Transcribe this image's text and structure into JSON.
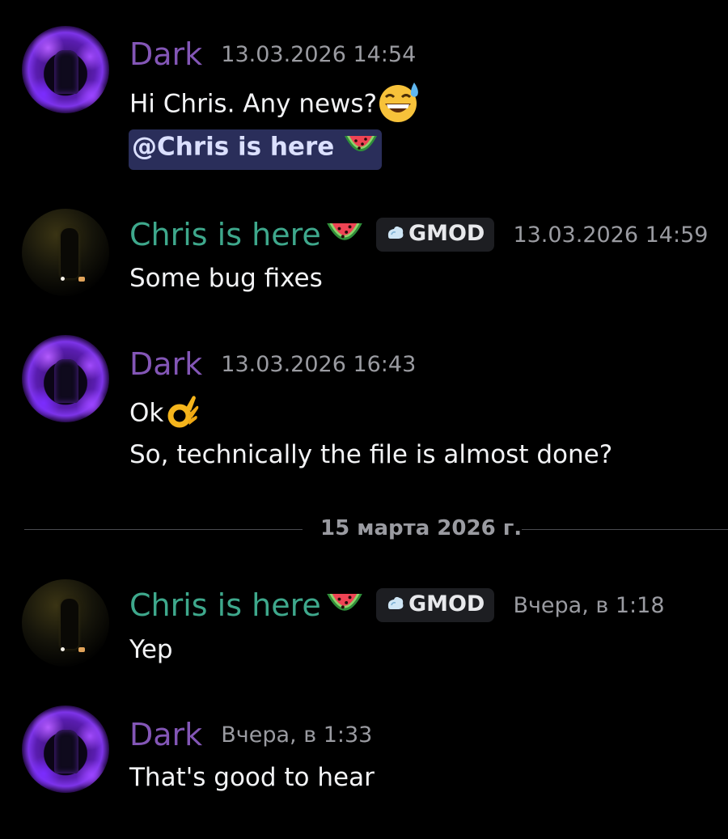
{
  "colors": {
    "background": "#000000",
    "dark_name": "#8356b6",
    "chris_name": "#3ea88c",
    "timestamp": "#9a9ba1",
    "mention_bg": "#2a2e5a",
    "tag_bg": "#1d1e22"
  },
  "messages": [
    {
      "author": "Dark",
      "timestamp": "13.03.2026 14:54",
      "lines": [
        "Hi Chris. Any news?"
      ],
      "line_emoji": "grinning-sweat-emoji",
      "mention": "@Chris is here",
      "mention_emoji": "watermelon-emoji"
    },
    {
      "author": "Chris is here",
      "author_emoji": "watermelon-emoji",
      "tag": "GMOD",
      "tag_icon": "dewdrop-icon",
      "timestamp": "13.03.2026 14:59",
      "lines": [
        "Some  bug fixes"
      ]
    },
    {
      "author": "Dark",
      "timestamp": "13.03.2026 16:43",
      "lines": [
        "Ok",
        "So, technically the file is almost done?"
      ],
      "line_emoji": "ok-hand-emoji"
    },
    {
      "author": "Chris is here",
      "author_emoji": "watermelon-emoji",
      "tag": "GMOD",
      "tag_icon": "dewdrop-icon",
      "timestamp": "Вчера, в 1:18",
      "lines": [
        "Yep"
      ]
    },
    {
      "author": "Dark",
      "timestamp": "Вчера, в 1:33",
      "lines": [
        "That's good to hear"
      ]
    }
  ],
  "date_divider": "15 марта 2026 г."
}
